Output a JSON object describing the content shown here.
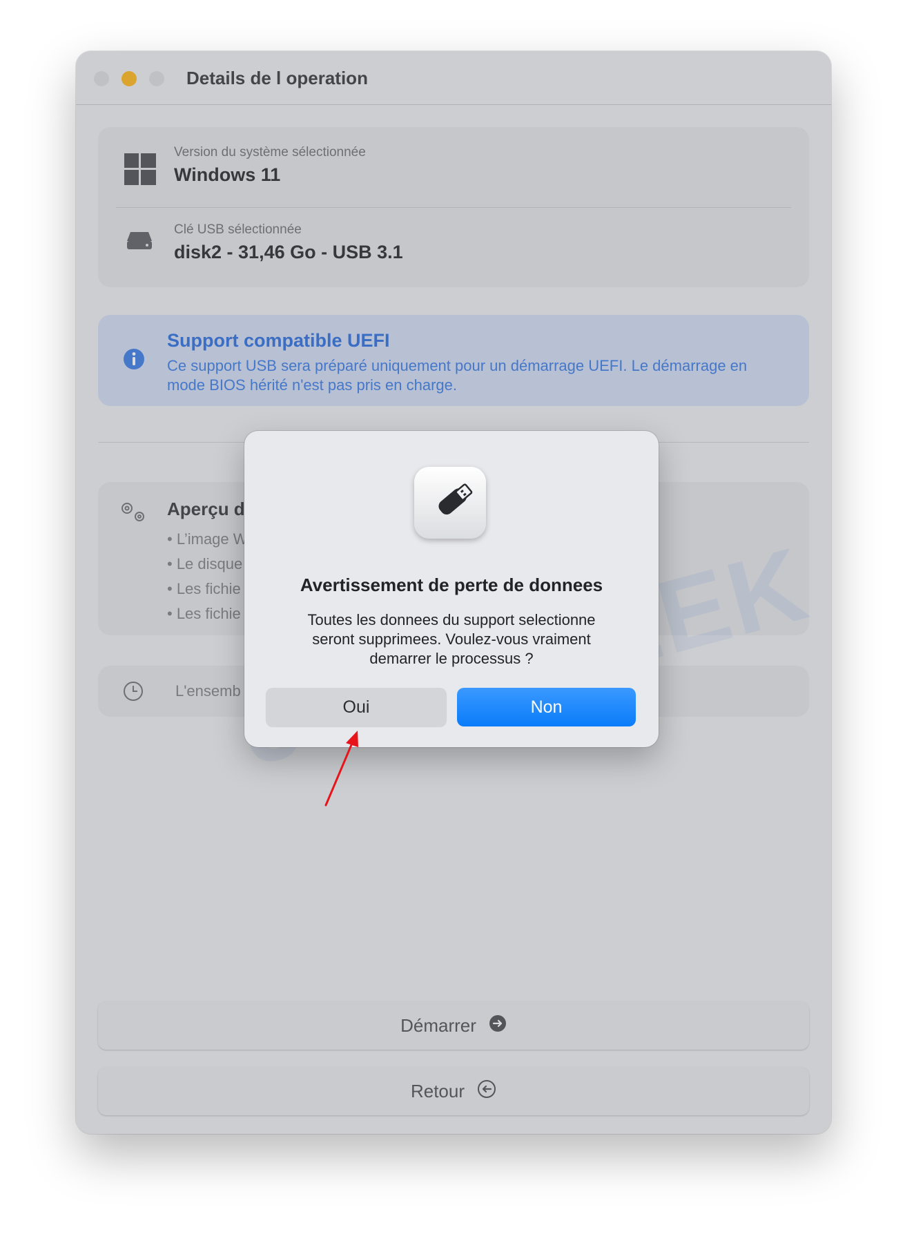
{
  "window": {
    "title": "Details de l operation"
  },
  "system": {
    "version_label": "Version du système sélectionnée",
    "version_value": "Windows 11",
    "usb_label": "Clé USB sélectionnée",
    "usb_value": "disk2 - 31,46 Go - USB 3.1"
  },
  "uefi": {
    "title": "Support compatible UEFI",
    "text": "Ce support USB sera préparé uniquement pour un démarrage UEFI. Le démarrage en mode BIOS hérité n'est pas pris en charge."
  },
  "overview": {
    "title": "Aperçu d",
    "bullets": [
      "• L’image W",
      "• Le disque",
      "• Les fichie",
      "• Les fichie"
    ]
  },
  "time": {
    "text": "L'ensemb"
  },
  "buttons": {
    "start": "Démarrer",
    "back": "Retour"
  },
  "watermark": "JUSTGEEK",
  "dialog": {
    "title": "Avertissement de perte de donnees",
    "message": "Toutes les donnees du support selectionne seront supprimees. Voulez-vous vraiment demarrer le processus ?",
    "yes": "Oui",
    "no": "Non"
  },
  "colors": {
    "accent_blue": "#0a7cf9",
    "info_blue": "#4d87e6",
    "arrow_red": "#e8141b",
    "minimize_yellow": "#febc2e"
  }
}
